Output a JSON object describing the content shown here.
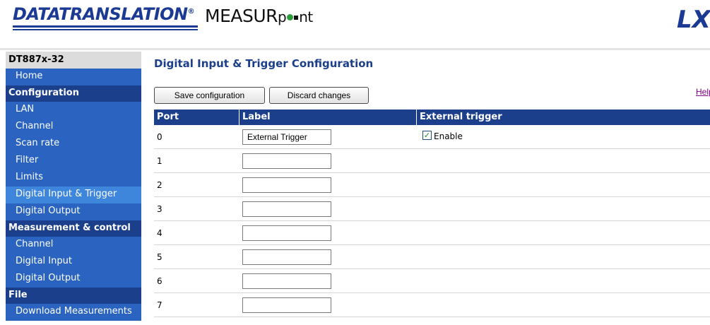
{
  "header": {
    "brand": "DATATRANSLATION",
    "brand_reg": "®",
    "product_a": "MEASUR",
    "product_b": "p",
    "product_c": "nt",
    "lxi": "LXI"
  },
  "sidebar": {
    "device": "DT887x-32",
    "home": "Home",
    "sections": [
      {
        "title": "Configuration",
        "items": [
          "LAN",
          "Channel",
          "Scan rate",
          "Filter",
          "Limits",
          "Digital Input & Trigger",
          "Digital Output"
        ]
      },
      {
        "title": "Measurement & control",
        "items": [
          "Channel",
          "Digital Input",
          "Digital Output"
        ]
      },
      {
        "title": "File",
        "items": [
          "Download Measurements"
        ]
      }
    ],
    "active_item": "Digital Input & Trigger"
  },
  "main": {
    "title": "Digital Input & Trigger Configuration",
    "save_label": "Save configuration",
    "discard_label": "Discard changes",
    "help_label": "Help",
    "columns": [
      "Port",
      "Label",
      "External trigger"
    ],
    "rows": [
      {
        "port": "0",
        "label": "External Trigger"
      },
      {
        "port": "1",
        "label": ""
      },
      {
        "port": "2",
        "label": ""
      },
      {
        "port": "3",
        "label": ""
      },
      {
        "port": "4",
        "label": ""
      },
      {
        "port": "5",
        "label": ""
      },
      {
        "port": "6",
        "label": ""
      },
      {
        "port": "7",
        "label": ""
      }
    ],
    "trigger_enable_label": "Enable",
    "trigger_enabled": true
  },
  "colors": {
    "nav_dark": "#1b3f8b",
    "nav_item": "#2a63c0",
    "nav_active": "#3e85dc",
    "brand": "#1b3a94"
  }
}
